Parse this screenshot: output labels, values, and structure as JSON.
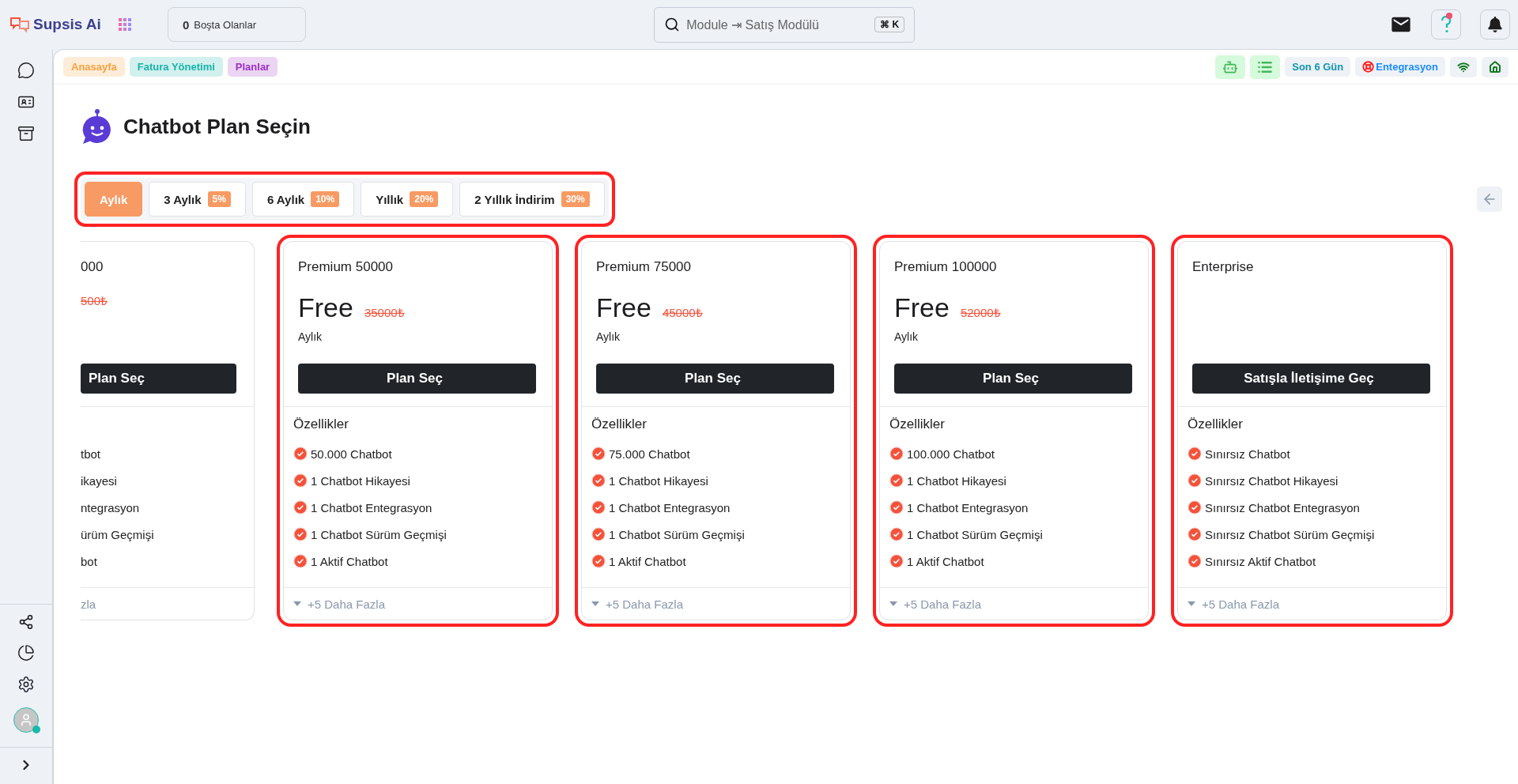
{
  "app": {
    "logo": "Supsis Ai"
  },
  "idle": {
    "count": "0",
    "label": "Boşta Olanlar"
  },
  "search": {
    "value": "Module ⇥ Satış Modülü",
    "shortcut": "⌘ K"
  },
  "help": {
    "unread": true
  },
  "breadcrumbs": [
    {
      "label": "Anasayfa",
      "color": "#f7a23e"
    },
    {
      "label": "Fatura Yönetimi",
      "color": "#17b3aa"
    },
    {
      "label": "Planlar",
      "color": "#9a2ec4"
    }
  ],
  "status": {
    "period": "Son 6 Gün",
    "integration": "Entegrasyon"
  },
  "page": {
    "title": "Chatbot Plan Seçin"
  },
  "periods": {
    "highlighted": true,
    "tabs": [
      {
        "label": "Aylık",
        "selected": true
      },
      {
        "label": "3 Aylık",
        "discount": "5%",
        "selected": false
      },
      {
        "label": "6 Aylık",
        "discount": "10%",
        "selected": false
      },
      {
        "label": "Yıllık",
        "discount": "20%",
        "selected": false
      },
      {
        "label": "2 Yıllık İndirim",
        "discount": "30%",
        "selected": false
      }
    ]
  },
  "plans": [
    {
      "kind": "partial",
      "name": "000",
      "old_price": "500₺",
      "button": "Plan Seç",
      "features": [
        "tbot",
        "ikayesi",
        "ntegrasyon",
        "ürüm Geçmişi",
        "bot"
      ],
      "more": "zla"
    },
    {
      "kind": "full",
      "highlighted": true,
      "name": "Premium 50000",
      "price": "Free",
      "old_price": "35000₺",
      "period": "Aylık",
      "button": "Plan Seç",
      "features_title": "Özellikler",
      "features": [
        "50.000 Chatbot",
        "1 Chatbot Hikayesi",
        "1 Chatbot Entegrasyon",
        "1 Chatbot Sürüm Geçmişi",
        "1 Aktif Chatbot"
      ],
      "more": "+5 Daha Fazla"
    },
    {
      "kind": "full",
      "highlighted": true,
      "name": "Premium 75000",
      "price": "Free",
      "old_price": "45000₺",
      "period": "Aylık",
      "button": "Plan Seç",
      "features_title": "Özellikler",
      "features": [
        "75.000 Chatbot",
        "1 Chatbot Hikayesi",
        "1 Chatbot Entegrasyon",
        "1 Chatbot Sürüm Geçmişi",
        "1 Aktif Chatbot"
      ],
      "more": "+5 Daha Fazla"
    },
    {
      "kind": "full",
      "highlighted": true,
      "name": "Premium 100000",
      "price": "Free",
      "old_price": "52000₺",
      "period": "Aylık",
      "button": "Plan Seç",
      "features_title": "Özellikler",
      "features": [
        "100.000 Chatbot",
        "1 Chatbot Hikayesi",
        "1 Chatbot Entegrasyon",
        "1 Chatbot Sürüm Geçmişi",
        "1 Aktif Chatbot"
      ],
      "more": "+5 Daha Fazla"
    },
    {
      "kind": "full",
      "highlighted": true,
      "name": "Enterprise",
      "button": "Satışla İletişime Geç",
      "features_title": "Özellikler",
      "features": [
        "Sınırsız Chatbot",
        "Sınırsız Chatbot Hikayesi",
        "Sınırsız Chatbot Entegrasyon",
        "Sınırsız Chatbot Sürüm Geçmişi",
        "Sınırsız Aktif Chatbot"
      ],
      "more": "+5 Daha Fazla"
    }
  ]
}
